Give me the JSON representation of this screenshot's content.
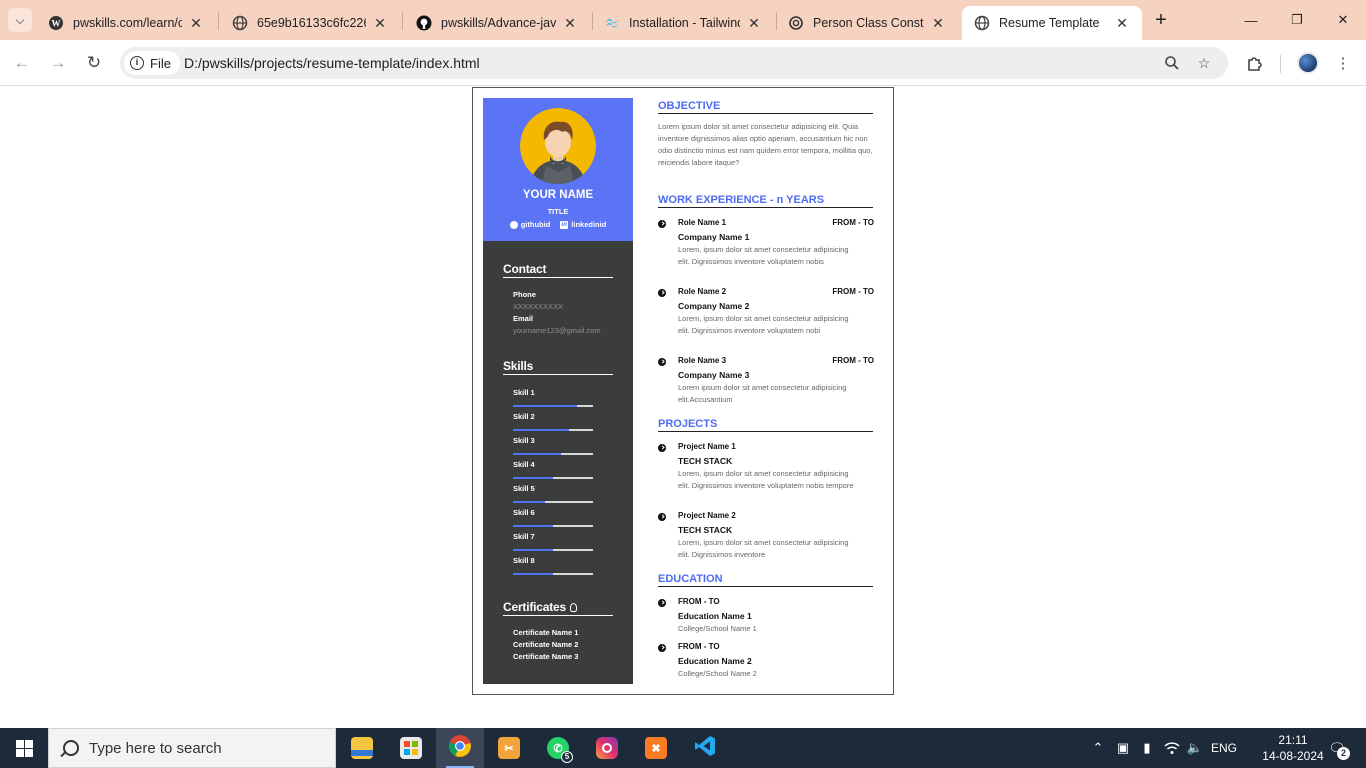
{
  "browser": {
    "tabs": [
      {
        "label": "pwskills.com/learn/cc",
        "icon": "wordpress-icon"
      },
      {
        "label": "65e9b16133c6fc226d",
        "icon": "globe-icon"
      },
      {
        "label": "pwskills/Advance-java",
        "icon": "github-icon"
      },
      {
        "label": "Installation - Tailwind",
        "icon": "tailwind-icon"
      },
      {
        "label": "Person Class Constru",
        "icon": "openai-icon"
      },
      {
        "label": "Resume Template",
        "icon": "globe-icon",
        "active": true
      }
    ],
    "site_chip": "File",
    "url": "D:/pwskills/projects/resume-template/index.html"
  },
  "resume": {
    "name": "YOUR NAME",
    "title": "TITLE",
    "github": "githubid",
    "linkedin": "linkedinid",
    "contact": {
      "heading": "Contact",
      "phone_label": "Phone",
      "phone_value": "XXXXXXXXXX",
      "email_label": "Email",
      "email_value": "yourname123@gmail.com"
    },
    "skills": {
      "heading": "Skills",
      "items": [
        {
          "label": "Skill 1",
          "level": 0.8
        },
        {
          "label": "Skill 2",
          "level": 0.7
        },
        {
          "label": "Skill 3",
          "level": 0.6
        },
        {
          "label": "Skill 4",
          "level": 0.5
        },
        {
          "label": "Skill 5",
          "level": 0.4
        },
        {
          "label": "Skill 6",
          "level": 0.5
        },
        {
          "label": "Skill 7",
          "level": 0.5
        },
        {
          "label": "Skill 8",
          "level": 0.5
        }
      ]
    },
    "certificates": {
      "heading": "Certificates",
      "items": [
        "Certificate Name 1",
        "Certificate Name 2",
        "Certificate Name 3"
      ]
    },
    "objective": {
      "heading": "OBJECTIVE",
      "text": "Lorem ipsum dolor sit amet consectetur adipisicing elit. Quia inventore dignissimos alias optio aperiam, accusantium hic non odio distinctio minus est nam quidem error tempora, mollitia quo, reiciendis labore itaque?"
    },
    "experience": {
      "heading": "WORK EXPERIENCE - n YEARS",
      "items": [
        {
          "role": "Role Name 1",
          "range": "FROM - TO",
          "company": "Company Name 1",
          "desc": "Lorem, ipsum dolor sit amet consectetur adipisicing elit. Dignissimos inventore voluptatem nobis"
        },
        {
          "role": "Role Name 2",
          "range": "FROM - TO",
          "company": "Company Name 2",
          "desc": "Lorem, ipsum dolor sit amet consectetur adipisicing elit. Dignissimos inventore voluptatem nobi"
        },
        {
          "role": "Role Name 3",
          "range": "FROM - TO",
          "company": "Company Name 3",
          "desc": "Lorem ipsum dolor sit amet consectetur adipisicing elit.Accusantium"
        }
      ]
    },
    "projects": {
      "heading": "PROJECTS",
      "items": [
        {
          "name": "Project Name 1",
          "stack": "TECH STACK",
          "desc": "Lorem, ipsum dolor sit amet consectetur adipisicing elit. Dignissimos inventore voluptatem nobis tempore"
        },
        {
          "name": "Project Name 2",
          "stack": "TECH STACK",
          "desc": "Lorem, ipsum dolor sit amet consectetur adipisicing elit. Dignissimos inventore"
        }
      ]
    },
    "education": {
      "heading": "EDUCATION",
      "items": [
        {
          "range": "FROM - TO",
          "name": "Education Name 1",
          "school": "College/School Name 1"
        },
        {
          "range": "FROM - TO",
          "name": "Education Name 2",
          "school": "College/School Name 2"
        }
      ]
    }
  },
  "taskbar": {
    "search_placeholder": "Type here to search",
    "whatsapp_badge": "5",
    "language": "ENG",
    "time": "21:11",
    "date": "14-08-2024",
    "notifications": "2"
  },
  "colors": {
    "accent": "#5b73f5",
    "sidebar": "#3a3d3b",
    "tabbar": "#f6d2c0",
    "taskbar": "#1d2a3a"
  }
}
